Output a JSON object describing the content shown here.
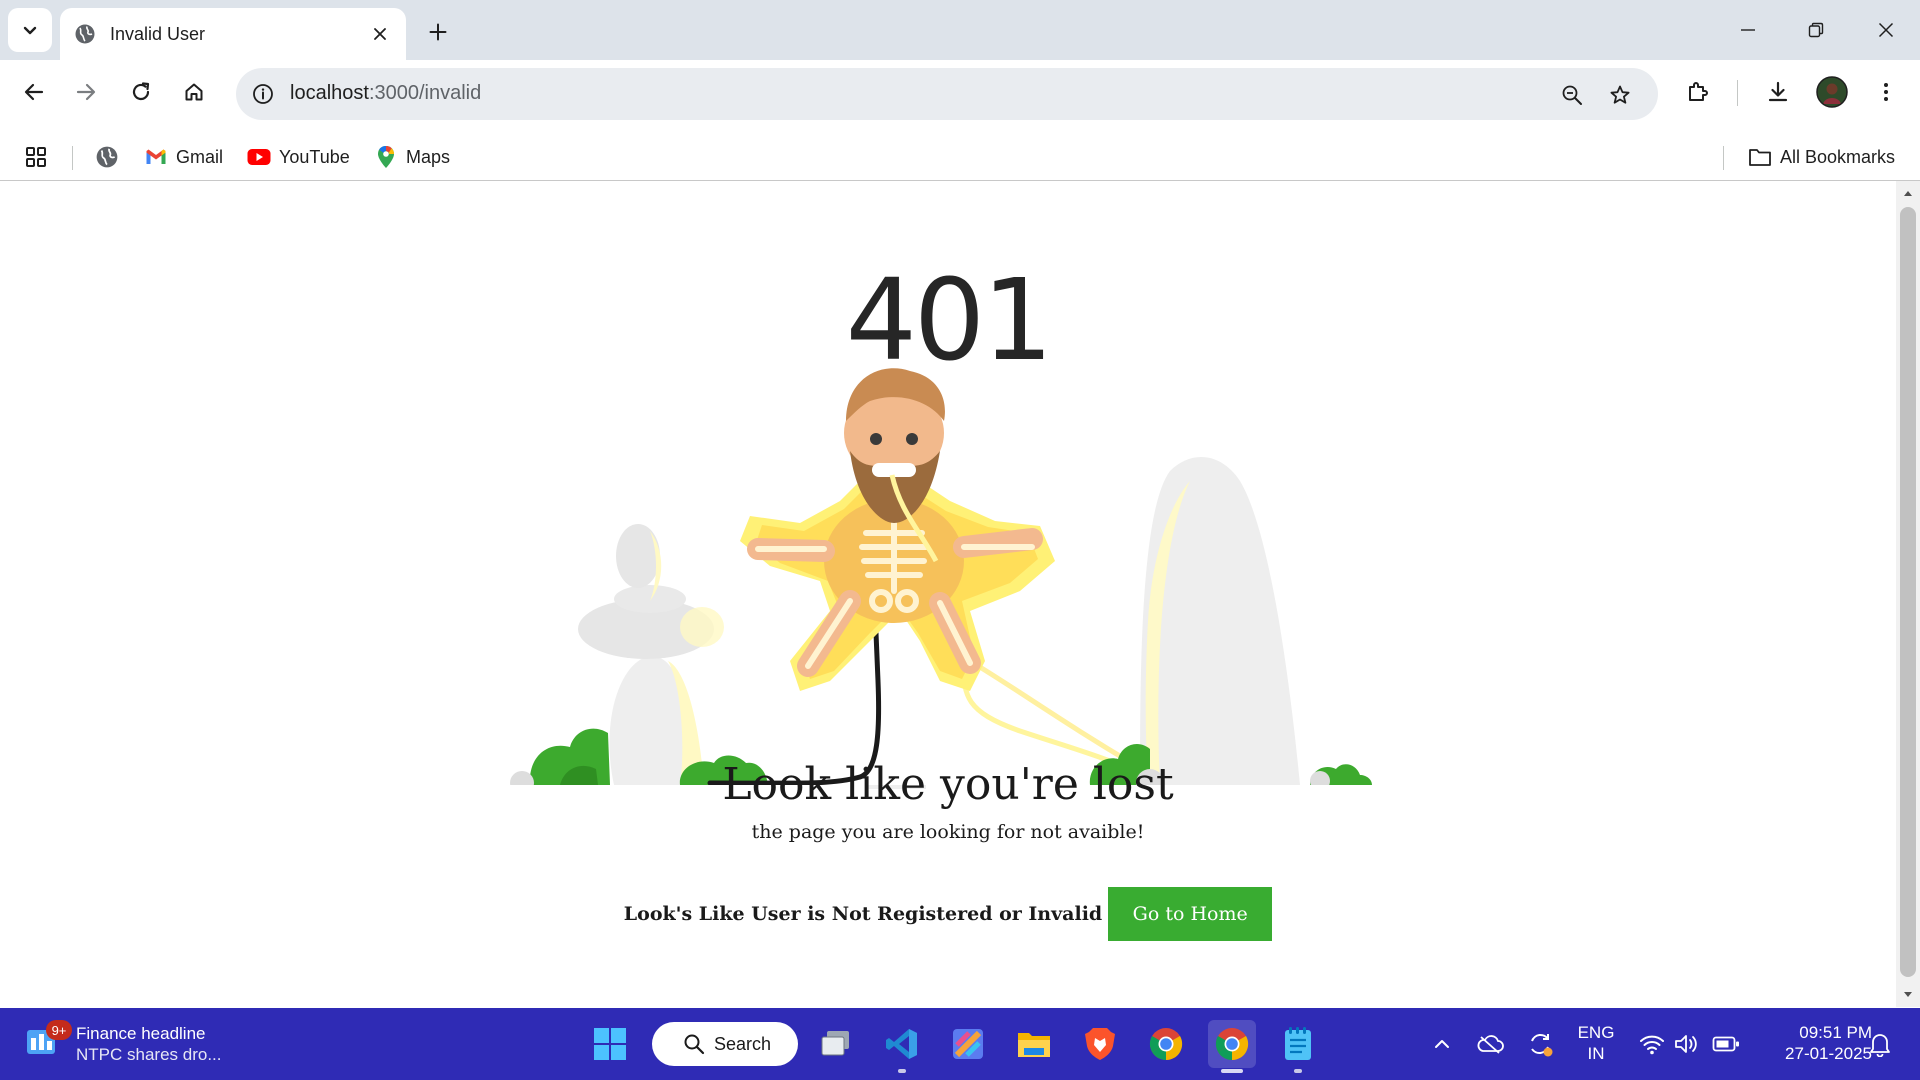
{
  "browser": {
    "tab_title": "Invalid User",
    "url_host": "localhost",
    "url_path": ":3000/invalid",
    "bookmarks": [
      {
        "label": "Gmail",
        "icon": "gmail-icon"
      },
      {
        "label": "YouTube",
        "icon": "youtube-icon"
      },
      {
        "label": "Maps",
        "icon": "maps-icon"
      }
    ],
    "all_bookmarks_label": "All Bookmarks"
  },
  "page": {
    "error_code": "401",
    "title": "Look like you're lost",
    "subtitle": "the page you are looking for not avaible!",
    "invalid_message": "Look's Like User is Not Registered or Invalid",
    "home_button_label": "Go to Home",
    "button_color": "#39ac31"
  },
  "taskbar": {
    "news_badge": "9+",
    "news_headline": "Finance headline",
    "news_subline": "NTPC shares dro...",
    "search_label": "Search",
    "language_line1": "ENG",
    "language_line2": "IN",
    "time": "09:51 PM",
    "date": "27-01-2025",
    "color": "#2f2bb5"
  }
}
